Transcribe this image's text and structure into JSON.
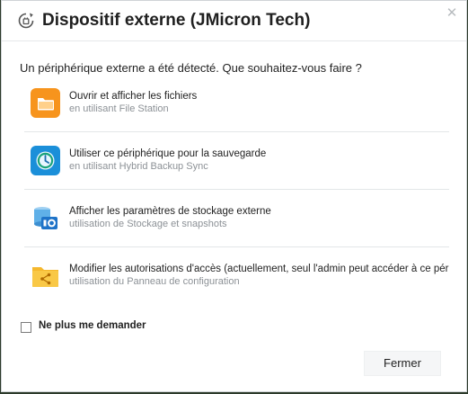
{
  "dialog": {
    "title": "Dispositif externe (JMicron Tech)",
    "close_glyph": "✕",
    "question": "Un périphérique externe a été détecté. Que souhaitez-vous faire ?"
  },
  "options": [
    {
      "title": "Ouvrir et afficher les fichiers",
      "subtitle": "en utilisant File Station",
      "icon": "folder-icon",
      "color": "#f7941d"
    },
    {
      "title": "Utiliser ce périphérique pour la sauvegarde",
      "subtitle": "en utilisant Hybrid Backup Sync",
      "icon": "backup-sync-icon",
      "color": "#1b8fd9"
    },
    {
      "title": "Afficher les paramètres de stockage externe",
      "subtitle": "utilisation de Stockage et snapshots",
      "icon": "storage-icon",
      "color": "#1e73c8"
    },
    {
      "title": "Modifier les autorisations d'accès (actuellement, seul l'admin peut accéder à ce périphérique)",
      "subtitle": "utilisation du Panneau de configuration",
      "icon": "shared-folder-icon",
      "color": "#f5b82e"
    }
  ],
  "checkbox": {
    "label": "Ne plus me demander",
    "checked": false
  },
  "buttons": {
    "close": "Fermer"
  }
}
